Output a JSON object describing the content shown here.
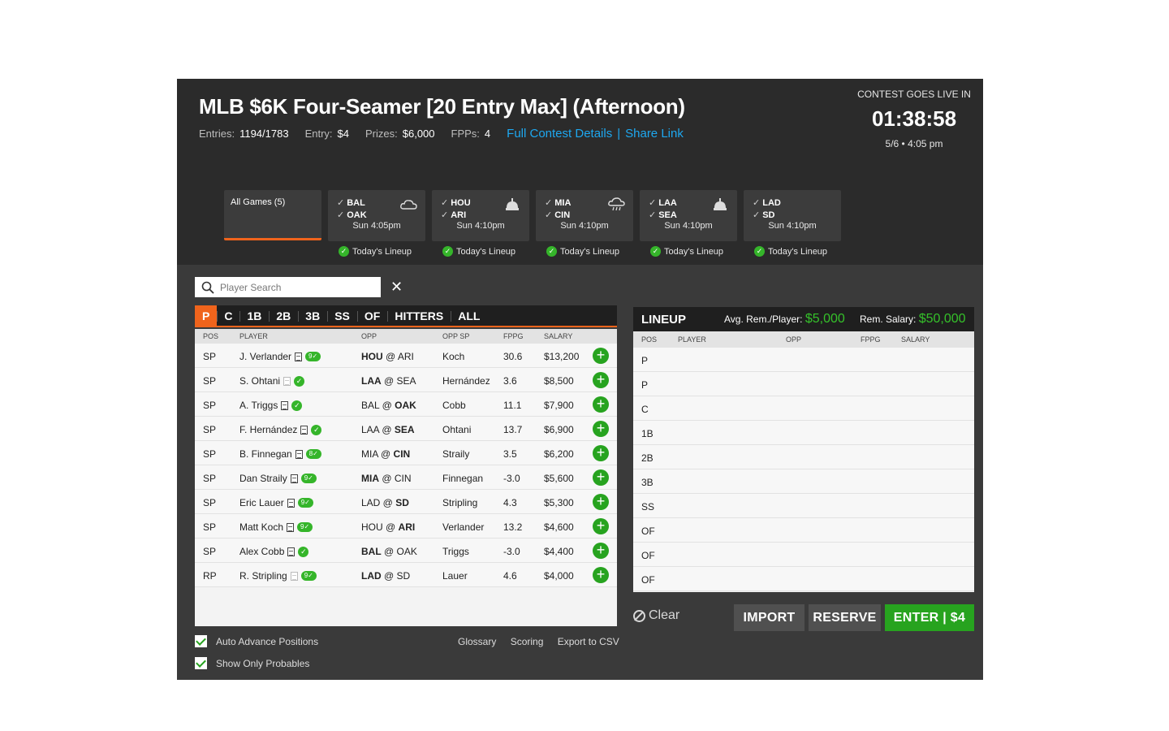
{
  "contest": {
    "title": "MLB $6K Four-Seamer [20 Entry Max] (Afternoon)",
    "entries_label": "Entries:",
    "entries_value": "1194/1783",
    "entry_label": "Entry:",
    "entry_value": "$4",
    "prizes_label": "Prizes:",
    "prizes_value": "$6,000",
    "fpps_label": "FPPs:",
    "fpps_value": "4",
    "details_link": "Full Contest Details",
    "separator": "|",
    "share_link": "Share Link"
  },
  "countdown": {
    "label": "CONTEST GOES LIVE IN",
    "time": "01:38:58",
    "date": "5/6 • 4:05 pm"
  },
  "games": {
    "all_label": "All Games (5)",
    "lineup_label": "Today's Lineup",
    "items": [
      {
        "away": "BAL",
        "home": "OAK",
        "time": "Sun 4:05pm",
        "weather_icon": "cloud-icon"
      },
      {
        "away": "HOU",
        "home": "ARI",
        "time": "Sun 4:10pm",
        "weather_icon": "dome-icon"
      },
      {
        "away": "MIA",
        "home": "CIN",
        "time": "Sun 4:10pm",
        "weather_icon": "rain-cloud-icon"
      },
      {
        "away": "LAA",
        "home": "SEA",
        "time": "Sun 4:10pm",
        "weather_icon": "dome-icon"
      },
      {
        "away": "LAD",
        "home": "SD",
        "time": "Sun 4:10pm",
        "weather_icon": ""
      }
    ]
  },
  "search": {
    "placeholder": "Player Search",
    "clear": "✕"
  },
  "position_tabs": [
    "P",
    "C",
    "1B",
    "2B",
    "3B",
    "SS",
    "OF",
    "HITTERS",
    "ALL"
  ],
  "player_table": {
    "columns": [
      "POS",
      "PLAYER",
      "OPP",
      "OPP SP",
      "FPPG",
      "SALARY"
    ],
    "rows": [
      {
        "pos": "SP",
        "name": "J. Verlander",
        "badge": "9",
        "away": "HOU",
        "home": "ARI",
        "bold": "away",
        "opp_sp": "Koch",
        "fppg": "30.6",
        "salary": "$13,200",
        "doc_light": false
      },
      {
        "pos": "SP",
        "name": "S. Ohtani",
        "badge": "",
        "away": "LAA",
        "home": "SEA",
        "bold": "away",
        "opp_sp": "Hernández",
        "fppg": "3.6",
        "salary": "$8,500",
        "doc_light": true
      },
      {
        "pos": "SP",
        "name": "A. Triggs",
        "badge": "",
        "away": "BAL",
        "home": "OAK",
        "bold": "home",
        "opp_sp": "Cobb",
        "fppg": "11.1",
        "salary": "$7,900",
        "doc_light": false
      },
      {
        "pos": "SP",
        "name": "F. Hernández",
        "badge": "",
        "away": "LAA",
        "home": "SEA",
        "bold": "home",
        "opp_sp": "Ohtani",
        "fppg": "13.7",
        "salary": "$6,900",
        "doc_light": false
      },
      {
        "pos": "SP",
        "name": "B. Finnegan",
        "badge": "8",
        "away": "MIA",
        "home": "CIN",
        "bold": "home",
        "opp_sp": "Straily",
        "fppg": "3.5",
        "salary": "$6,200",
        "doc_light": false
      },
      {
        "pos": "SP",
        "name": "Dan Straily",
        "badge": "9",
        "away": "MIA",
        "home": "CIN",
        "bold": "away",
        "opp_sp": "Finnegan",
        "fppg": "-3.0",
        "salary": "$5,600",
        "doc_light": false
      },
      {
        "pos": "SP",
        "name": "Eric Lauer",
        "badge": "9",
        "away": "LAD",
        "home": "SD",
        "bold": "home",
        "opp_sp": "Stripling",
        "fppg": "4.3",
        "salary": "$5,300",
        "doc_light": false
      },
      {
        "pos": "SP",
        "name": "Matt Koch",
        "badge": "9",
        "away": "HOU",
        "home": "ARI",
        "bold": "home",
        "opp_sp": "Verlander",
        "fppg": "13.2",
        "salary": "$4,600",
        "doc_light": false
      },
      {
        "pos": "SP",
        "name": "Alex Cobb",
        "badge": "",
        "away": "BAL",
        "home": "OAK",
        "bold": "away",
        "opp_sp": "Triggs",
        "fppg": "-3.0",
        "salary": "$4,400",
        "doc_light": false
      },
      {
        "pos": "RP",
        "name": "R. Stripling",
        "badge": "9",
        "away": "LAD",
        "home": "SD",
        "bold": "away",
        "opp_sp": "Lauer",
        "fppg": "4.6",
        "salary": "$4,000",
        "doc_light": true
      }
    ]
  },
  "lineup": {
    "title": "LINEUP",
    "avg_label": "Avg. Rem./Player:",
    "avg_value": "$5,000",
    "rem_label": "Rem. Salary:",
    "rem_value": "$50,000",
    "columns": [
      "POS",
      "PLAYER",
      "OPP",
      "FPPG",
      "SALARY"
    ],
    "slots": [
      "P",
      "P",
      "C",
      "1B",
      "2B",
      "3B",
      "SS",
      "OF",
      "OF",
      "OF"
    ]
  },
  "actions": {
    "clear": "Clear",
    "import": "IMPORT",
    "reserve": "RESERVE",
    "enter": "ENTER | $4"
  },
  "footer": {
    "auto_advance": "Auto Advance Positions",
    "show_probables": "Show Only Probables",
    "glossary": "Glossary",
    "scoring": "Scoring",
    "export": "Export to CSV"
  },
  "colors": {
    "accent": "#f0641c",
    "link": "#1ea8f0",
    "success": "#27a31f",
    "header_bg": "#2b2b2b",
    "panel_bg": "#3a3a3a"
  }
}
